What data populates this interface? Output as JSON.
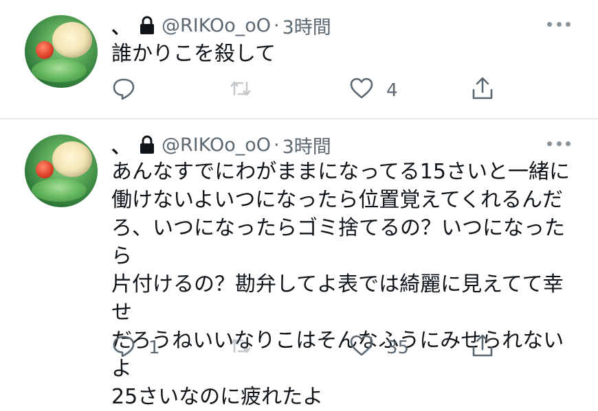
{
  "tweets": [
    {
      "display_name": "、",
      "handle": "@RIKOo_oO",
      "dot": "·",
      "time": "3時間",
      "text": "誰かりこを殺して",
      "reply_count": "",
      "retweet_count": "",
      "like_count": "4"
    },
    {
      "display_name": "、",
      "handle": "@RIKOo_oO",
      "dot": "·",
      "time": "3時間",
      "text": "あんなすでにわがままになってる15さいと一緒に\n働けないよいつになったら位置覚えてくれるんだ\nろ、いつになったらゴミ捨てるの？いつになったら\n片付けるの？勘弁してよ表では綺麗に見えてて幸せ\nだろうねいいなりこはそんなふうにみせられないよ\n25さいなのに疲れたよ",
      "reply_count": "1",
      "retweet_count": "",
      "like_count": "35"
    }
  ],
  "icons": {
    "lock": "lock-icon",
    "more": "more-options-icon",
    "reply": "reply-icon",
    "retweet": "retweet-icon",
    "like": "heart-icon",
    "share": "share-icon"
  },
  "colors": {
    "text": "#0f1419",
    "secondary": "#5b6770",
    "divider": "#e6ecf0"
  }
}
